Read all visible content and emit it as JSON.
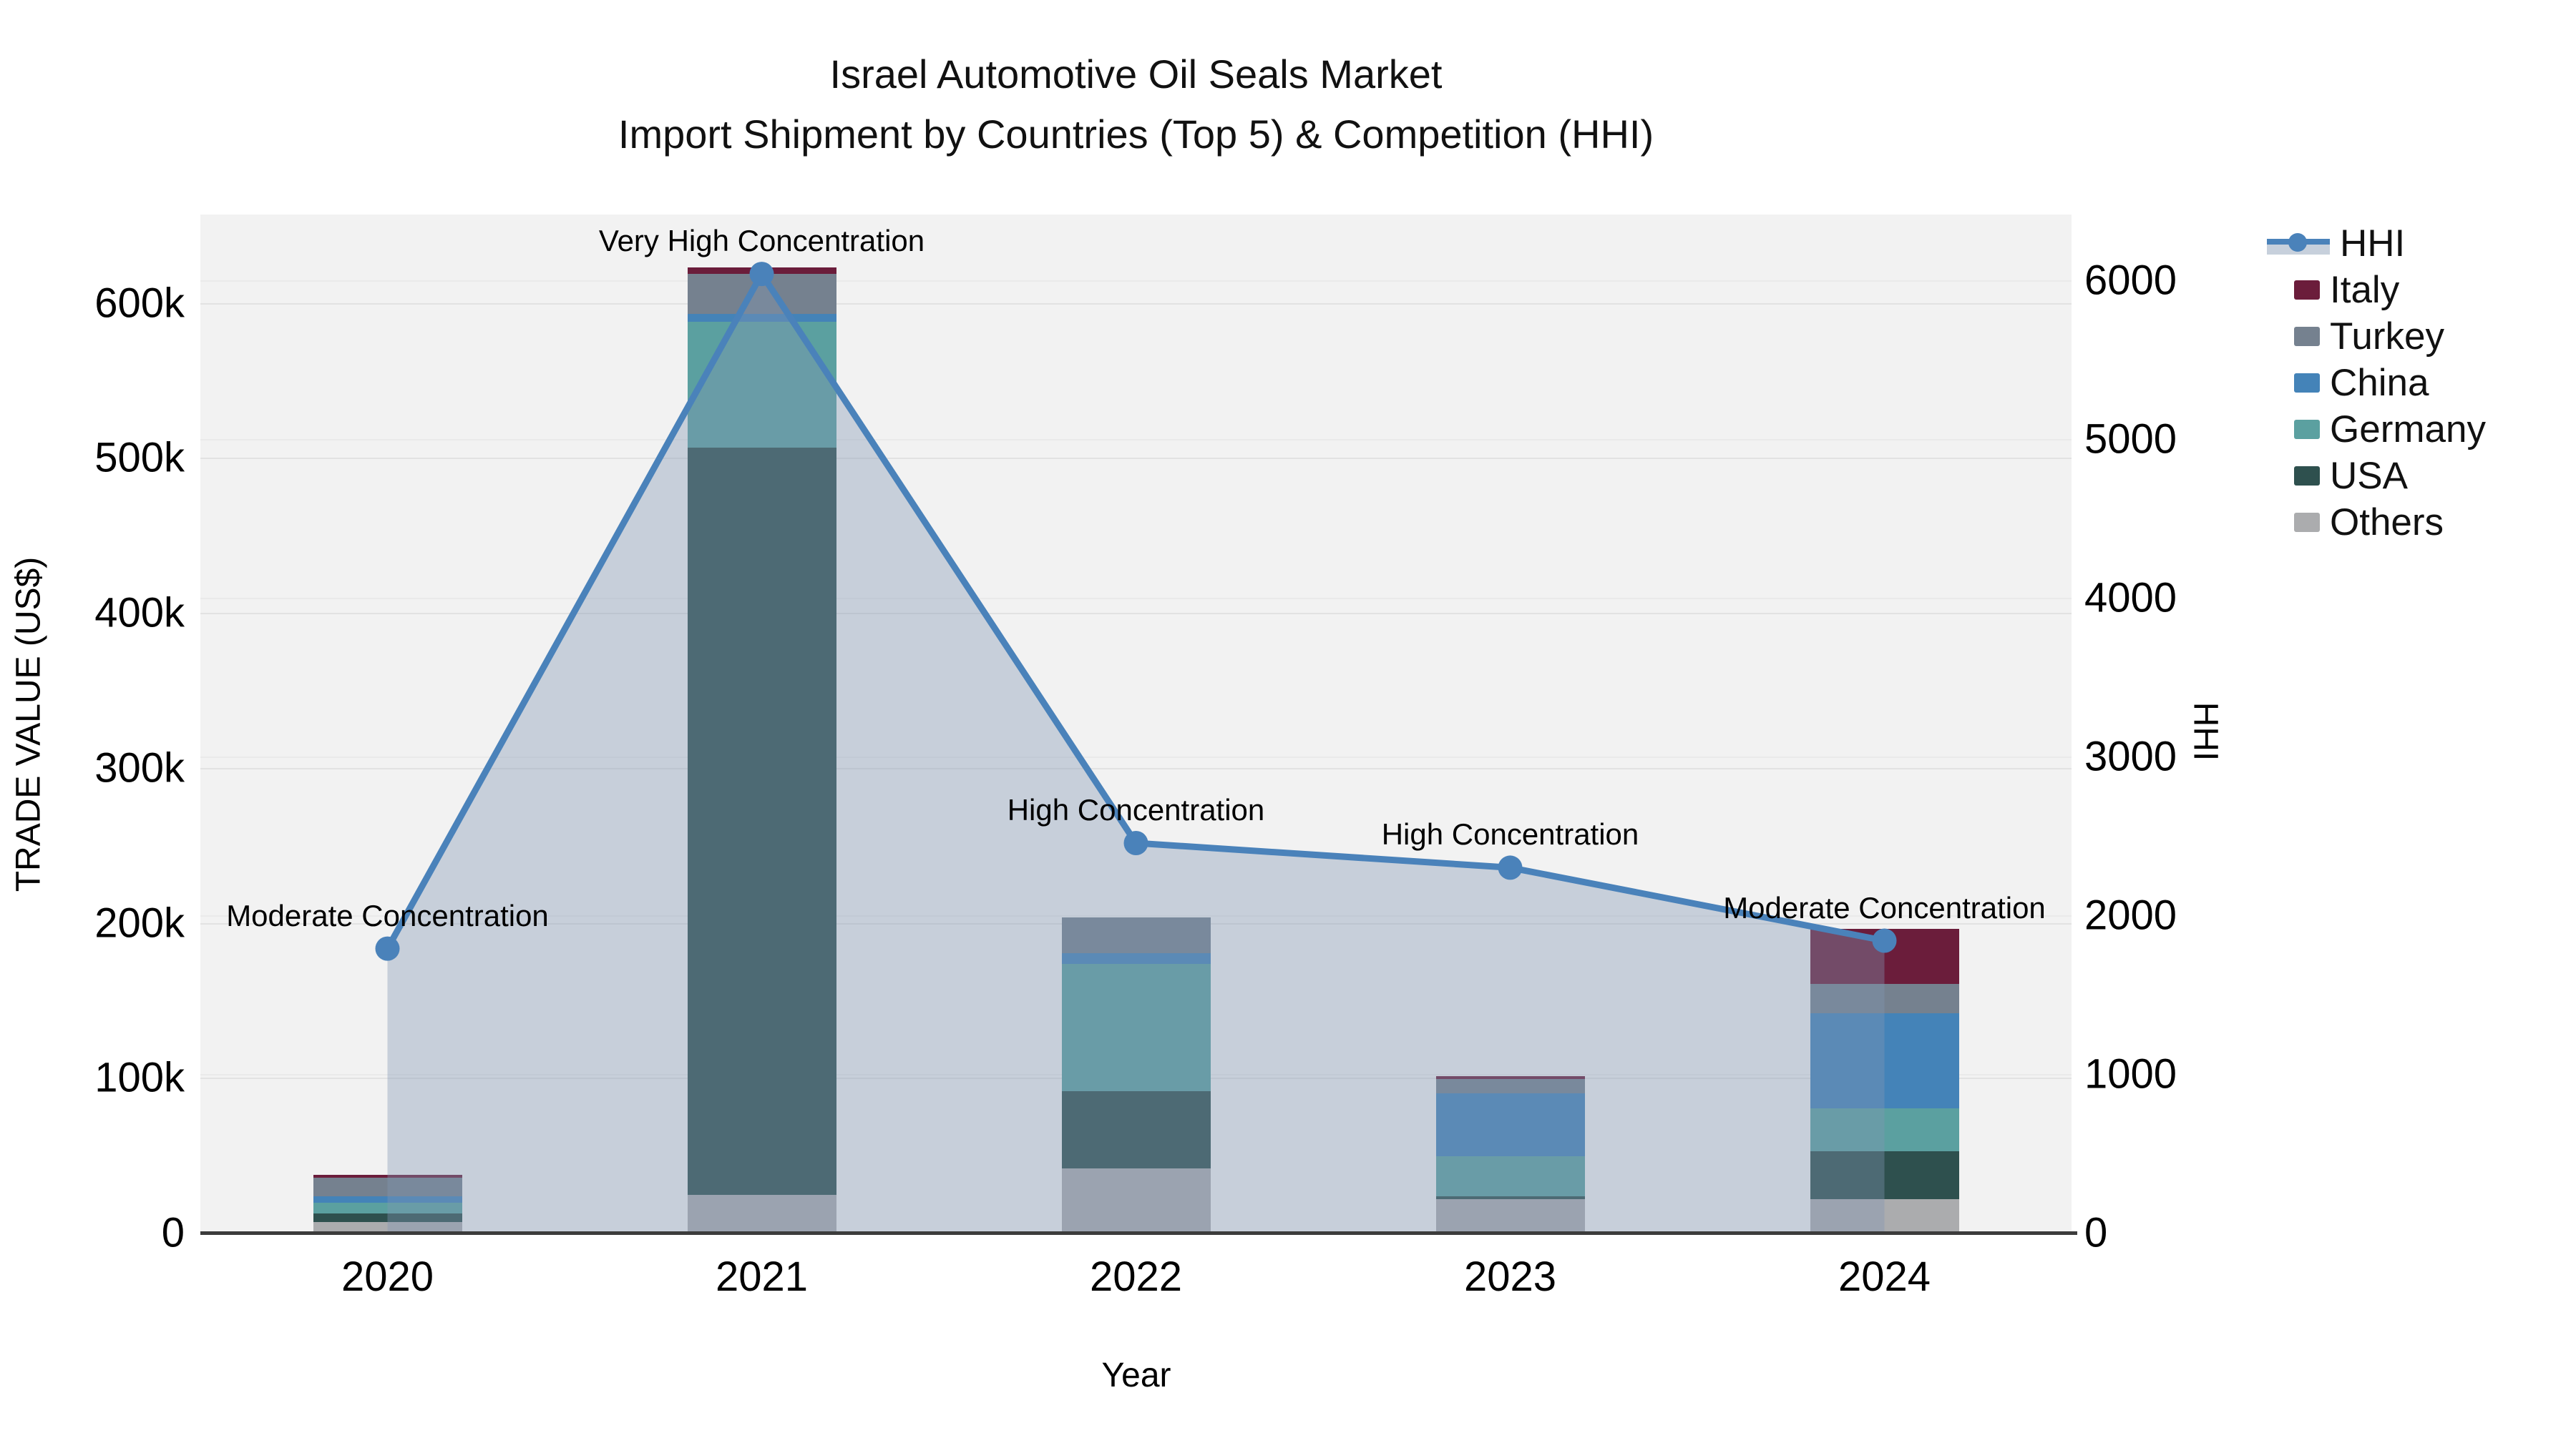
{
  "title": {
    "line1": "Israel Automotive Oil Seals Market",
    "line2": "Import Shipment by Countries (Top 5) & Competition (HHI)"
  },
  "chart_data": {
    "type": "combo-stacked-bar-and-line",
    "categories": [
      "2020",
      "2021",
      "2022",
      "2023",
      "2024"
    ],
    "series": [
      {
        "name": "Italy",
        "color": "#6b1d3b",
        "values": [
          2000,
          4500,
          0,
          2000,
          35500
        ]
      },
      {
        "name": "Turkey",
        "color": "#75818f",
        "values": [
          12000,
          25500,
          23000,
          9000,
          19000
        ]
      },
      {
        "name": "China",
        "color": "#4483b8",
        "values": [
          4000,
          5000,
          7000,
          40500,
          61000
        ]
      },
      {
        "name": "Germany",
        "color": "#5ba0a0",
        "values": [
          7000,
          81500,
          82000,
          26000,
          28000
        ]
      },
      {
        "name": "USA",
        "color": "#2e504e",
        "values": [
          5500,
          482000,
          50000,
          2000,
          31000
        ]
      },
      {
        "name": "Others",
        "color": "#abacae",
        "values": [
          7000,
          24500,
          41500,
          21500,
          21500
        ]
      }
    ],
    "stack_order_bottom_to_top": [
      "Others",
      "USA",
      "Germany",
      "China",
      "Turkey",
      "Italy"
    ],
    "line_series": {
      "name": "HHI",
      "color": "#4a82ba",
      "fill_color": "rgba(130,150,178,0.38)",
      "values": [
        1790,
        6040,
        2455,
        2300,
        1840
      ]
    },
    "annotations": [
      {
        "text": "Moderate Concentration",
        "x": "2020"
      },
      {
        "text": "Very High Concentration",
        "x": "2021"
      },
      {
        "text": "High Concentration",
        "x": "2022"
      },
      {
        "text": "High Concentration",
        "x": "2023"
      },
      {
        "text": "Moderate Concentration",
        "x": "2024"
      }
    ],
    "left_axis": {
      "title": "TRADE VALUE (US$)",
      "tick_labels": [
        "0",
        "100k",
        "200k",
        "300k",
        "400k",
        "500k",
        "600k"
      ],
      "tick_values": [
        0,
        100000,
        200000,
        300000,
        400000,
        500000,
        600000
      ],
      "range_max": 656000
    },
    "right_axis": {
      "title": "HHI",
      "tick_labels": [
        "0",
        "1000",
        "2000",
        "3000",
        "4000",
        "5000",
        "6000"
      ],
      "tick_values": [
        0,
        1000,
        2000,
        3000,
        4000,
        5000,
        6000
      ],
      "range_max": 6414
    },
    "x_axis": {
      "title": "Year"
    },
    "legend_position": "top-right",
    "grid": true,
    "plot_background": "#f2f2f2"
  },
  "legend": {
    "hhi_label": "HHI"
  }
}
